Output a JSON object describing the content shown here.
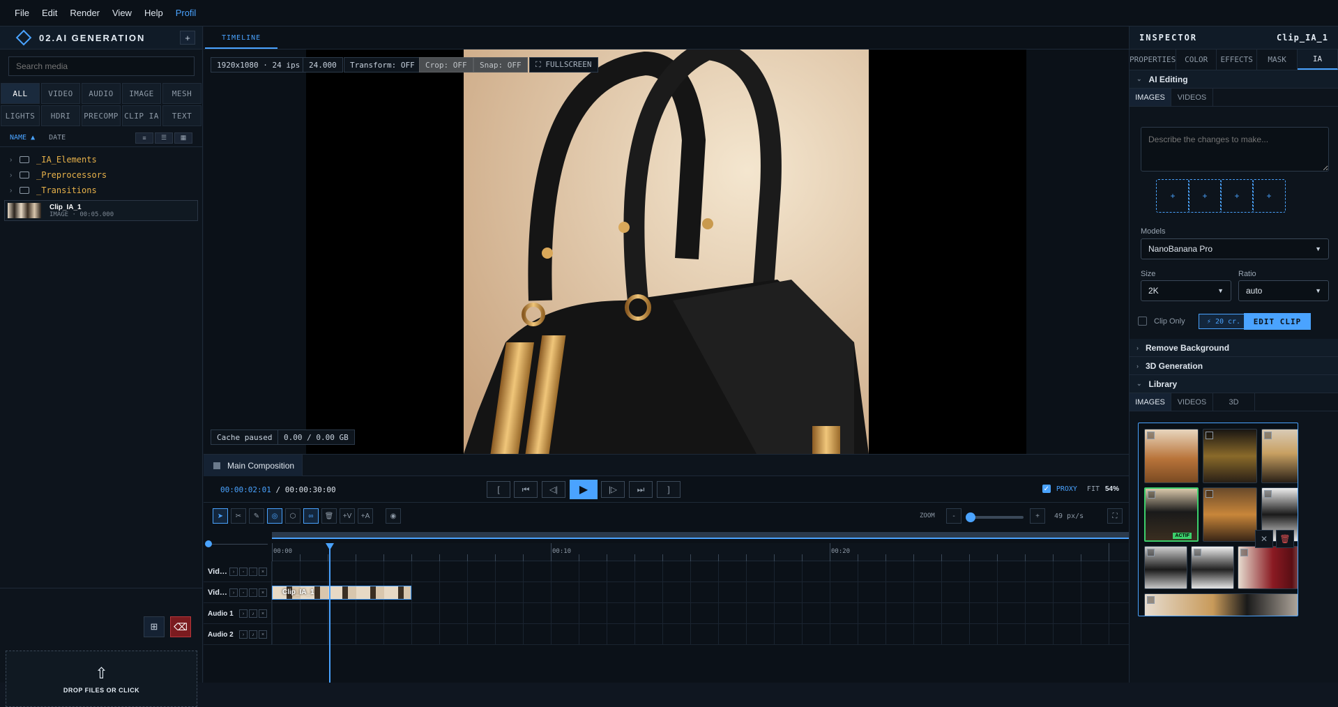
{
  "menu": [
    "File",
    "Edit",
    "Render",
    "View",
    "Help",
    "Profil"
  ],
  "project": {
    "title": "02.AI GENERATION",
    "add": "+"
  },
  "media": {
    "search_placeholder": "Search media",
    "filters": [
      "ALL",
      "VIDEO",
      "AUDIO",
      "IMAGE",
      "MESH",
      "LIGHTS",
      "HDRI",
      "PRECOMP",
      "CLIP IA",
      "TEXT"
    ],
    "sort": {
      "name": "NAME ▲",
      "date": "DATE"
    },
    "folders": [
      "_IA_Elements",
      "_Preprocessors",
      "_Transitions"
    ],
    "item": {
      "name": "Clip_IA_1",
      "meta": "IMAGE · 00:05.000"
    },
    "drop": "DROP FILES OR CLICK"
  },
  "center": {
    "tab": "TIMELINE",
    "badges": {
      "res": "1920x1080 · 24 ips",
      "fps": "24.000",
      "transform": "Transform: OFF",
      "crop": "Crop: OFF",
      "snap": "Snap: OFF",
      "fullscreen": "⛶ FULLSCREEN"
    },
    "cache": {
      "status": "Cache paused",
      "size": "0.00 / 0.00 GB"
    },
    "composition": "Main Composition",
    "timecode": {
      "current": "00:00:02:01",
      "sep": " / ",
      "total": "00:00:30:00"
    },
    "proxy": {
      "label": "PROXY",
      "fit": "FIT",
      "value": "54%"
    },
    "zoom": {
      "label": "ZOOM",
      "value": "49 px/s",
      "minus": "-",
      "plus": "+"
    },
    "ruler": [
      "00:00",
      "00:10",
      "00:20"
    ],
    "tracks": [
      "Vid…",
      "Vid…",
      "Audio 1",
      "Audio 2"
    ],
    "clip": "Clip_IA_1"
  },
  "inspector": {
    "title": "INSPECTOR",
    "clip": "Clip_IA_1",
    "tabs": [
      "PROPERTIES",
      "COLOR",
      "EFFECTS",
      "MASK",
      "IA"
    ],
    "ai_section": "AI Editing",
    "ai_tabs": [
      "IMAGES",
      "VIDEOS"
    ],
    "prompt_placeholder": "Describe the changes to make...",
    "slots": [
      "+",
      "+",
      "+",
      "+"
    ],
    "models_label": "Models",
    "model": "NanoBanana Pro",
    "size_label": "Size",
    "size": "2K",
    "ratio_label": "Ratio",
    "ratio": "auto",
    "clip_only": "Clip Only",
    "credits": "⚡ 20 cr.",
    "edit": "EDIT CLIP",
    "sections": [
      "Remove Background",
      "3D Generation",
      "Library"
    ],
    "lib_tabs": [
      "IMAGES",
      "VIDEOS",
      "3D"
    ],
    "active_badge": "ACTIF"
  },
  "colors": {
    "accent": "#4aa3ff",
    "bg": "#0b1118",
    "active": "#3ccf6b",
    "danger": "#b9373c"
  }
}
